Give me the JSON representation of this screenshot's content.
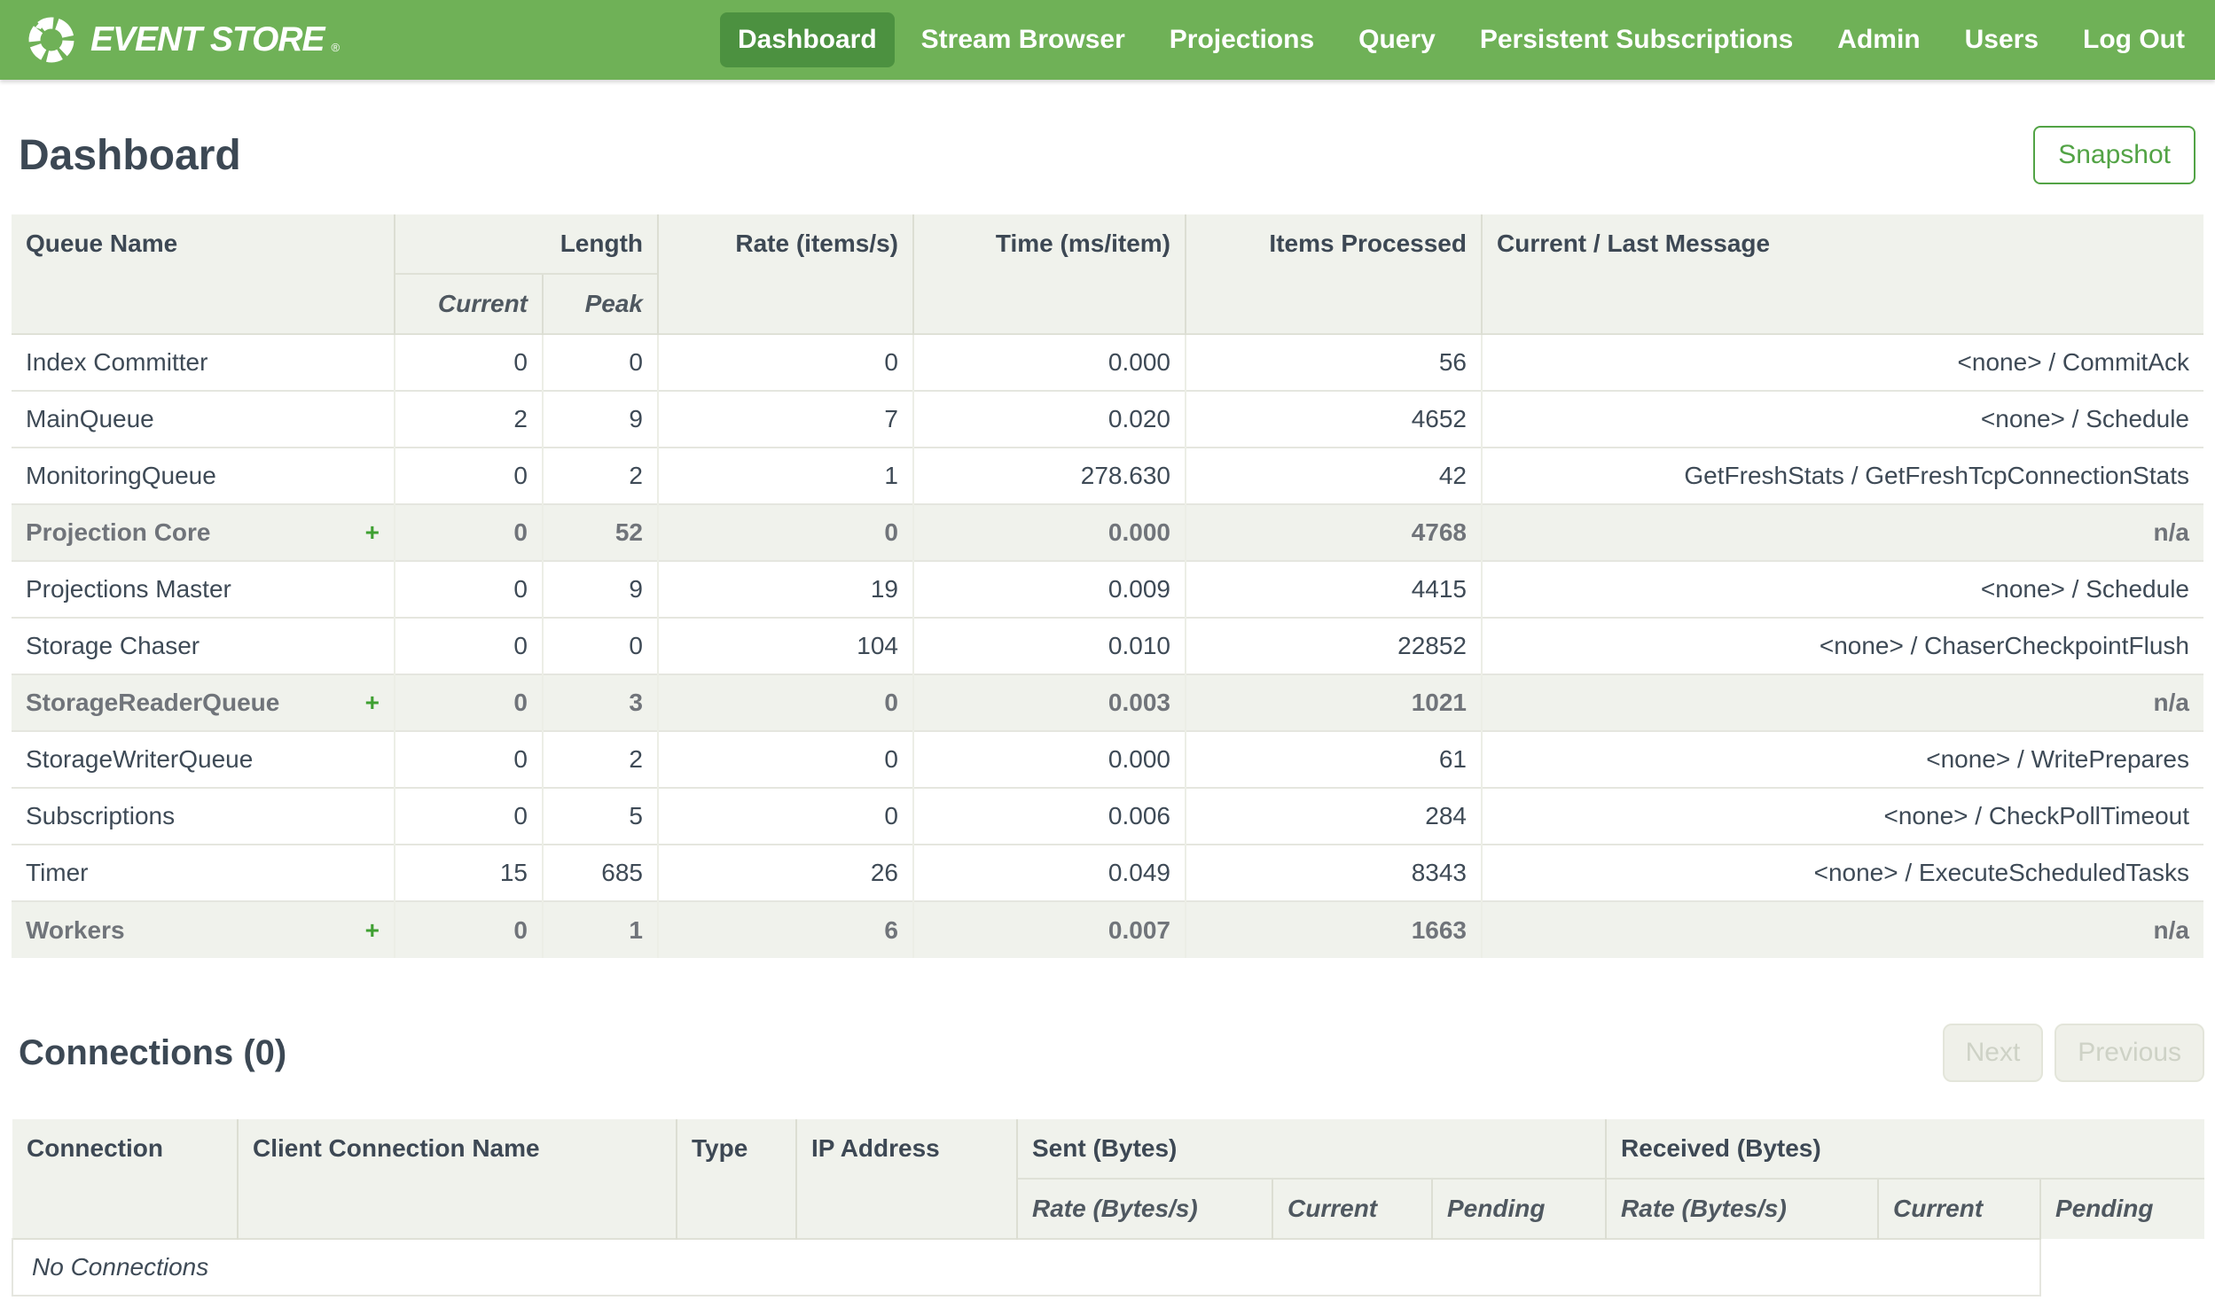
{
  "colors": {
    "navbar_green": "#6fb157",
    "active_nav_green": "#4c9140",
    "accent_green": "#52a345",
    "plus_green": "#3fa032",
    "header_bg": "#f0f2ec",
    "text_dark": "#3c4854"
  },
  "navbar": {
    "brand": "EVENT STORE",
    "brand_reg": "®",
    "items": [
      {
        "label": "Dashboard",
        "active": true
      },
      {
        "label": "Stream Browser",
        "active": false
      },
      {
        "label": "Projections",
        "active": false
      },
      {
        "label": "Query",
        "active": false
      },
      {
        "label": "Persistent Subscriptions",
        "active": false
      },
      {
        "label": "Admin",
        "active": false
      },
      {
        "label": "Users",
        "active": false
      },
      {
        "label": "Log Out",
        "active": false
      }
    ]
  },
  "page": {
    "title": "Dashboard",
    "snapshot_label": "Snapshot"
  },
  "queues": {
    "expand_symbol": "+",
    "headers": {
      "queue_name": "Queue Name",
      "length": "Length",
      "current": "Current",
      "peak": "Peak",
      "rate": "Rate (items/s)",
      "time": "Time (ms/item)",
      "items_processed": "Items Processed",
      "message": "Current / Last Message"
    },
    "rows": [
      {
        "name": "Index Committer",
        "group": false,
        "expandable": false,
        "current": "0",
        "peak": "0",
        "rate": "0",
        "time": "0.000",
        "items": "56",
        "message": "<none> / CommitAck"
      },
      {
        "name": "MainQueue",
        "group": false,
        "expandable": false,
        "current": "2",
        "peak": "9",
        "rate": "7",
        "time": "0.020",
        "items": "4652",
        "message": "<none> / Schedule"
      },
      {
        "name": "MonitoringQueue",
        "group": false,
        "expandable": false,
        "current": "0",
        "peak": "2",
        "rate": "1",
        "time": "278.630",
        "items": "42",
        "message": "GetFreshStats / GetFreshTcpConnectionStats"
      },
      {
        "name": "Projection Core",
        "group": true,
        "expandable": true,
        "current": "0",
        "peak": "52",
        "rate": "0",
        "time": "0.000",
        "items": "4768",
        "message": "n/a"
      },
      {
        "name": "Projections Master",
        "group": false,
        "expandable": false,
        "current": "0",
        "peak": "9",
        "rate": "19",
        "time": "0.009",
        "items": "4415",
        "message": "<none> / Schedule"
      },
      {
        "name": "Storage Chaser",
        "group": false,
        "expandable": false,
        "current": "0",
        "peak": "0",
        "rate": "104",
        "time": "0.010",
        "items": "22852",
        "message": "<none> / ChaserCheckpointFlush"
      },
      {
        "name": "StorageReaderQueue",
        "group": true,
        "expandable": true,
        "current": "0",
        "peak": "3",
        "rate": "0",
        "time": "0.003",
        "items": "1021",
        "message": "n/a"
      },
      {
        "name": "StorageWriterQueue",
        "group": false,
        "expandable": false,
        "current": "0",
        "peak": "2",
        "rate": "0",
        "time": "0.000",
        "items": "61",
        "message": "<none> / WritePrepares"
      },
      {
        "name": "Subscriptions",
        "group": false,
        "expandable": false,
        "current": "0",
        "peak": "5",
        "rate": "0",
        "time": "0.006",
        "items": "284",
        "message": "<none> / CheckPollTimeout"
      },
      {
        "name": "Timer",
        "group": false,
        "expandable": false,
        "current": "15",
        "peak": "685",
        "rate": "26",
        "time": "0.049",
        "items": "8343",
        "message": "<none> / ExecuteScheduledTasks"
      },
      {
        "name": "Workers",
        "group": true,
        "expandable": true,
        "current": "0",
        "peak": "1",
        "rate": "6",
        "time": "0.007",
        "items": "1663",
        "message": "n/a"
      }
    ]
  },
  "connections": {
    "title": "Connections (0)",
    "next_label": "Next",
    "previous_label": "Previous",
    "headers": {
      "connection": "Connection",
      "client_name": "Client Connection Name",
      "type": "Type",
      "ip": "IP Address",
      "sent": "Sent (Bytes)",
      "received": "Received (Bytes)",
      "rate": "Rate (Bytes/s)",
      "current": "Current",
      "pending": "Pending"
    },
    "empty_message": "No Connections"
  }
}
